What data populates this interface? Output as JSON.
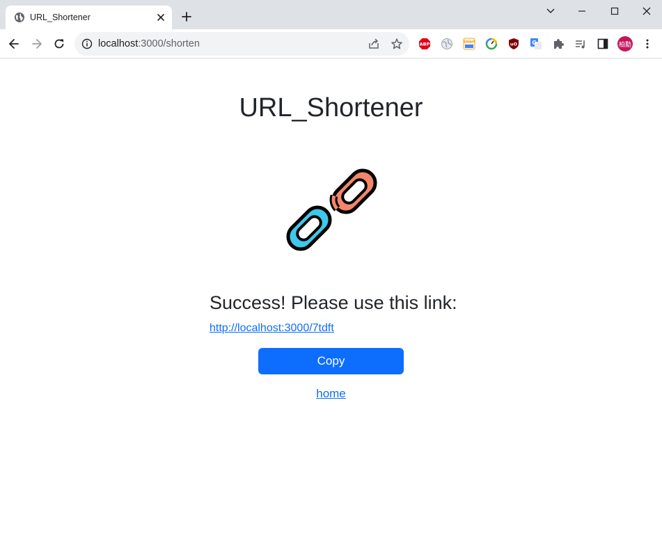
{
  "browser": {
    "tab": {
      "title": "URL_Shortener",
      "favicon": "globe-icon"
    },
    "address_bar": {
      "host": "localhost",
      "port_path": ":3000/shorten"
    },
    "profile": {
      "initials": "柏勳",
      "color": "#c2185b"
    },
    "extensions": [
      {
        "name": "adblock-plus-icon",
        "text": "ABP",
        "color": "#e2001a"
      },
      {
        "name": "globe-extension-icon",
        "text": "",
        "color": "#9aa0a6"
      },
      {
        "name": "smart-pm-icon",
        "text": "Smart",
        "color": "#f29900"
      },
      {
        "name": "gauge-extension-icon",
        "text": "",
        "color": "#34a853"
      },
      {
        "name": "ublock-origin-icon",
        "text": "uO",
        "color": "#800000"
      },
      {
        "name": "google-translate-icon",
        "text": "G",
        "color": "#4285f4"
      },
      {
        "name": "extensions-puzzle-icon",
        "text": "",
        "color": "#5f6368"
      },
      {
        "name": "media-queue-icon",
        "text": "",
        "color": "#5f6368"
      },
      {
        "name": "side-panel-icon",
        "text": "",
        "color": "#5f6368"
      }
    ]
  },
  "page": {
    "title": "URL_Shortener",
    "success_message": "Success! Please use this link:",
    "short_url": "http://localhost:3000/7tdft",
    "copy_label": "Copy",
    "home_label": "home"
  },
  "colors": {
    "primary": "#0d6efd",
    "chain_orange": "#f2866a",
    "chain_blue": "#3dc8ec",
    "text": "#212529"
  }
}
